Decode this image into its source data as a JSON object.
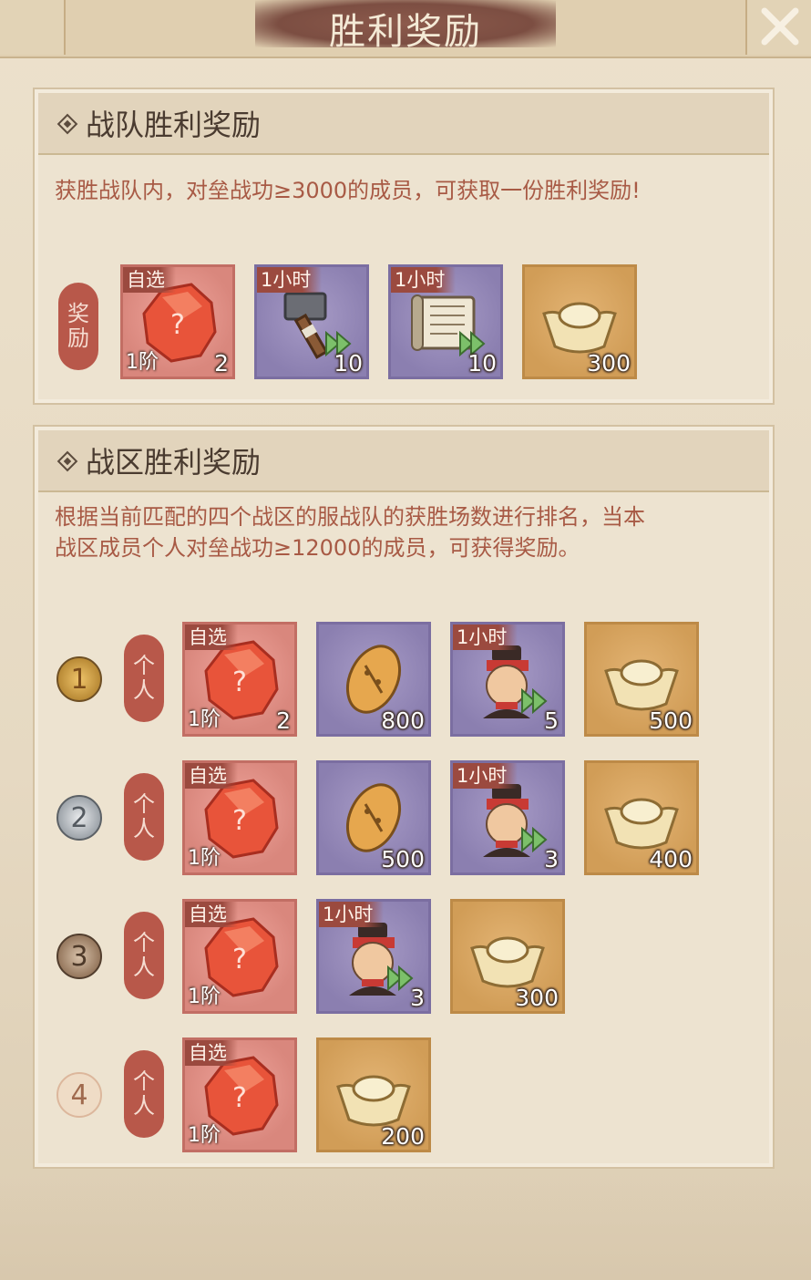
{
  "title": "胜利奖励",
  "team_section": {
    "title": "战队胜利奖励",
    "description": "获胜战队内，对垒战功≥3000的成员，可获取一份胜利奖励!",
    "seal_label": [
      "奖",
      "励"
    ],
    "rewards": [
      {
        "icon": "crystal-icon",
        "frame": "red",
        "tag": "自选",
        "tier": "1阶",
        "count": "2"
      },
      {
        "icon": "hammer-icon",
        "frame": "purple",
        "tag": "1小时",
        "count": "10",
        "speed": true
      },
      {
        "icon": "scroll-icon",
        "frame": "purple",
        "tag": "1小时",
        "count": "10",
        "speed": true
      },
      {
        "icon": "gold-ingot-icon",
        "frame": "gold",
        "count": "300"
      }
    ]
  },
  "zone_section": {
    "title": "战区胜利奖励",
    "description_line1": "根据当前匹配的四个战区的服战队的获胜场数进行排名，当本",
    "description_line2": "战区成员个人对垒战功≥12000的成员，可获得奖励。",
    "seal_label": [
      "个",
      "人"
    ],
    "ranks": [
      {
        "rank": "1",
        "rewards": [
          {
            "icon": "crystal-icon",
            "frame": "red",
            "tag": "自选",
            "tier": "1阶",
            "count": "2"
          },
          {
            "icon": "seed-icon",
            "frame": "purple",
            "count": "800"
          },
          {
            "icon": "soldier-icon",
            "frame": "purple",
            "tag": "1小时",
            "count": "5",
            "speed": true
          },
          {
            "icon": "gold-ingot-icon",
            "frame": "gold",
            "count": "500"
          }
        ]
      },
      {
        "rank": "2",
        "rewards": [
          {
            "icon": "crystal-icon",
            "frame": "red",
            "tag": "自选",
            "tier": "1阶",
            "count": ""
          },
          {
            "icon": "seed-icon",
            "frame": "purple",
            "count": "500"
          },
          {
            "icon": "soldier-icon",
            "frame": "purple",
            "tag": "1小时",
            "count": "3",
            "speed": true
          },
          {
            "icon": "gold-ingot-icon",
            "frame": "gold",
            "count": "400"
          }
        ]
      },
      {
        "rank": "3",
        "rewards": [
          {
            "icon": "crystal-icon",
            "frame": "red",
            "tag": "自选",
            "tier": "1阶",
            "count": ""
          },
          {
            "icon": "soldier-icon",
            "frame": "purple",
            "tag": "1小时",
            "count": "3",
            "speed": true
          },
          {
            "icon": "gold-ingot-icon",
            "frame": "gold",
            "count": "300"
          }
        ]
      },
      {
        "rank": "4",
        "rewards": [
          {
            "icon": "crystal-icon",
            "frame": "red",
            "tag": "自选",
            "tier": "1阶",
            "count": ""
          },
          {
            "icon": "gold-ingot-icon",
            "frame": "gold",
            "count": "200"
          }
        ]
      }
    ]
  }
}
